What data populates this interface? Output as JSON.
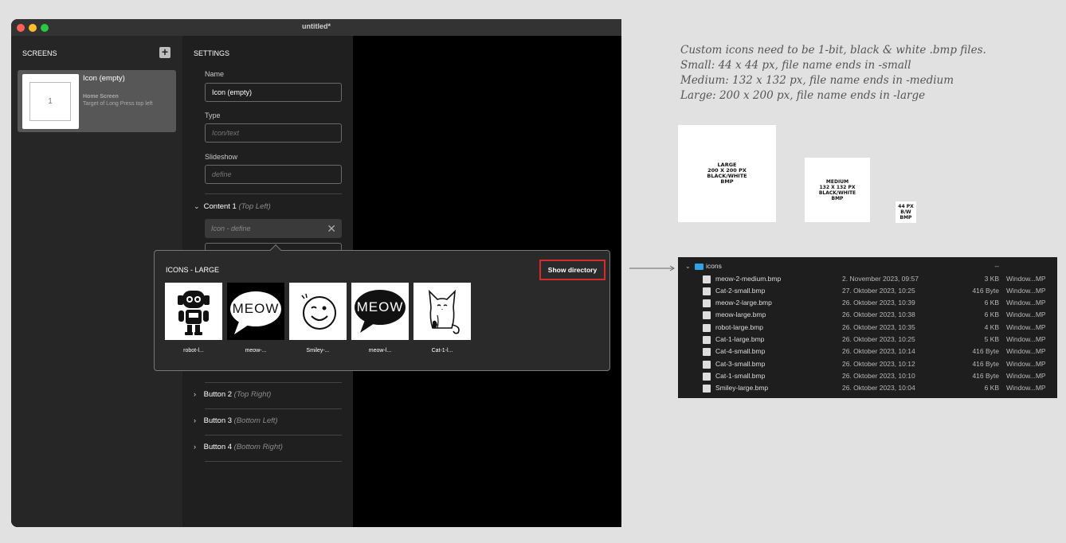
{
  "window": {
    "title": "untitled*"
  },
  "screens": {
    "label": "SCREENS",
    "add_icon": "+",
    "card": {
      "thumb_number": "1",
      "name": "Icon (empty)",
      "subtitle": "Home Screen",
      "description": "Target of Long Press top left"
    }
  },
  "settings": {
    "label": "SETTINGS",
    "name_label": "Name",
    "name_value": "Icon (empty)",
    "type_label": "Type",
    "type_placeholder": "Icon/text",
    "slideshow_label": "Slideshow",
    "slideshow_placeholder": "define",
    "content1": {
      "title": "Content 1",
      "position": "(Top Left)",
      "icon_placeholder": "Icon - define"
    },
    "buttons": [
      {
        "title": "Button 2",
        "position": "(Top Right)"
      },
      {
        "title": "Button 3",
        "position": "(Bottom Left)"
      },
      {
        "title": "Button 4",
        "position": "(Bottom Right)"
      }
    ]
  },
  "popover": {
    "title": "ICONS - LARGE",
    "show_directory": "Show directory",
    "icons": [
      {
        "label": "robot-l...",
        "kind": "robot"
      },
      {
        "label": "meow-...",
        "kind": "meow-white",
        "text": "MEOW"
      },
      {
        "label": "Smiley-...",
        "kind": "smiley"
      },
      {
        "label": "meow-l...",
        "kind": "meow-black",
        "text": "MEOW"
      },
      {
        "label": "Cat-1-l...",
        "kind": "cat"
      }
    ]
  },
  "note": {
    "lines": [
      "Custom icons need to be 1-bit, black & white .bmp files.",
      "Small: 44 x 44 px, file name ends in -small",
      "Medium: 132 x 132 px, file name ends in -medium",
      "Large: 200 x 200 px, file name ends in -large"
    ]
  },
  "samples": {
    "large": "LARGE\n200 X 200 PX\nBLACK/WHITE\nBMP",
    "medium": "MEDIUM\n132 X 132 PX\nBLACK/WHITE\nBMP",
    "small": "44 PX\nB/W\nBMP"
  },
  "finder": {
    "folder": {
      "name": "icons",
      "size": "--"
    },
    "files": [
      {
        "name": "meow-2-medium.bmp",
        "date": "2. November 2023, 09:57",
        "size": "3 KB",
        "kind": "Window...MP"
      },
      {
        "name": "Cat-2-small.bmp",
        "date": "27. Oktober 2023, 10:25",
        "size": "416 Byte",
        "kind": "Window...MP"
      },
      {
        "name": "meow-2-large.bmp",
        "date": "26. Oktober 2023, 10:39",
        "size": "6 KB",
        "kind": "Window...MP"
      },
      {
        "name": "meow-large.bmp",
        "date": "26. Oktober 2023, 10:38",
        "size": "6 KB",
        "kind": "Window...MP"
      },
      {
        "name": "robot-large.bmp",
        "date": "26. Oktober 2023, 10:35",
        "size": "4 KB",
        "kind": "Window...MP"
      },
      {
        "name": "Cat-1-large.bmp",
        "date": "26. Oktober 2023, 10:25",
        "size": "5 KB",
        "kind": "Window...MP"
      },
      {
        "name": "Cat-4-small.bmp",
        "date": "26. Oktober 2023, 10:14",
        "size": "416 Byte",
        "kind": "Window...MP"
      },
      {
        "name": "Cat-3-small.bmp",
        "date": "26. Oktober 2023, 10:12",
        "size": "416 Byte",
        "kind": "Window...MP"
      },
      {
        "name": "Cat-1-small.bmp",
        "date": "26. Oktober 2023, 10:10",
        "size": "416 Byte",
        "kind": "Window...MP"
      },
      {
        "name": "Smiley-large.bmp",
        "date": "26. Oktober 2023, 10:04",
        "size": "6 KB",
        "kind": "Window...MP"
      }
    ]
  }
}
